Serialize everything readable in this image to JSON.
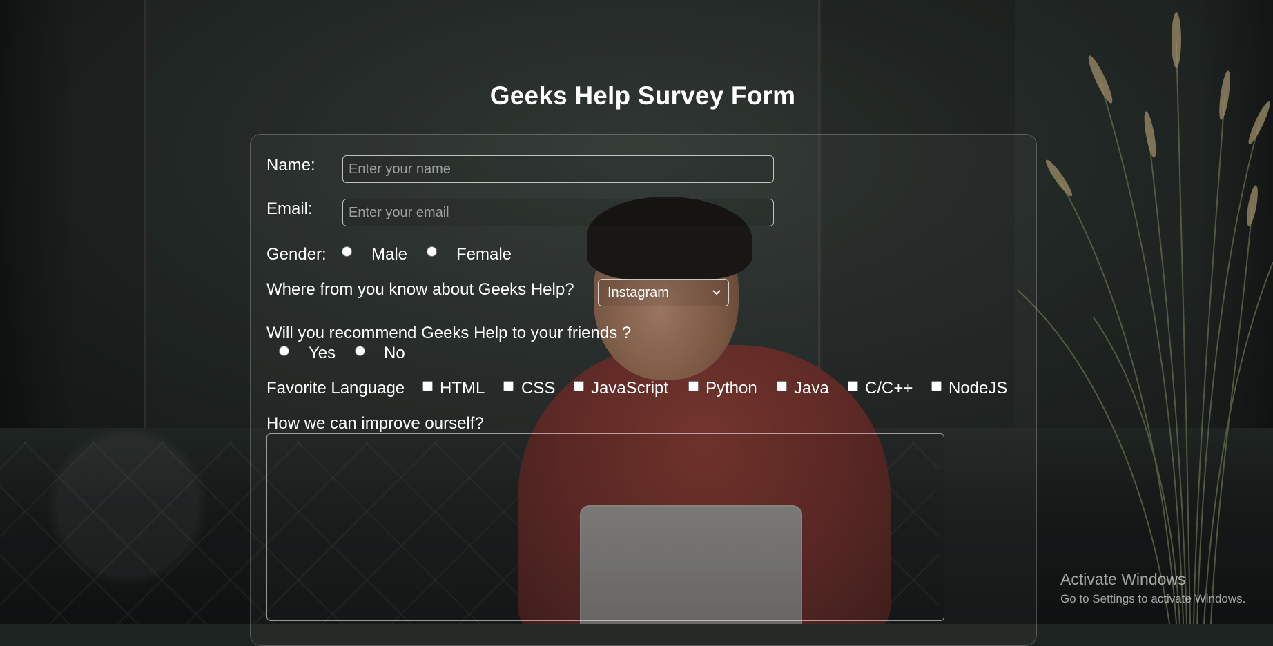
{
  "title": "Geeks Help Survey Form",
  "name": {
    "label": "Name:",
    "placeholder": "Enter your name"
  },
  "email": {
    "label": "Email:",
    "placeholder": "Enter your email"
  },
  "gender": {
    "label": "Gender:",
    "options": [
      "Male",
      "Female"
    ]
  },
  "source": {
    "label": "Where from you know about Geeks Help?",
    "selected": "Instagram"
  },
  "recommend": {
    "label": "Will you recommend Geeks Help to your friends ?",
    "options": [
      "Yes",
      "No"
    ]
  },
  "languages": {
    "label": "Favorite Language",
    "options": [
      "HTML",
      "CSS",
      "JavaScript",
      "Python",
      "Java",
      "C/C++",
      "NodeJS"
    ]
  },
  "improve": {
    "label": "How we can improve ourself?"
  },
  "watermark": {
    "title": "Activate Windows",
    "subtitle": "Go to Settings to activate Windows."
  }
}
